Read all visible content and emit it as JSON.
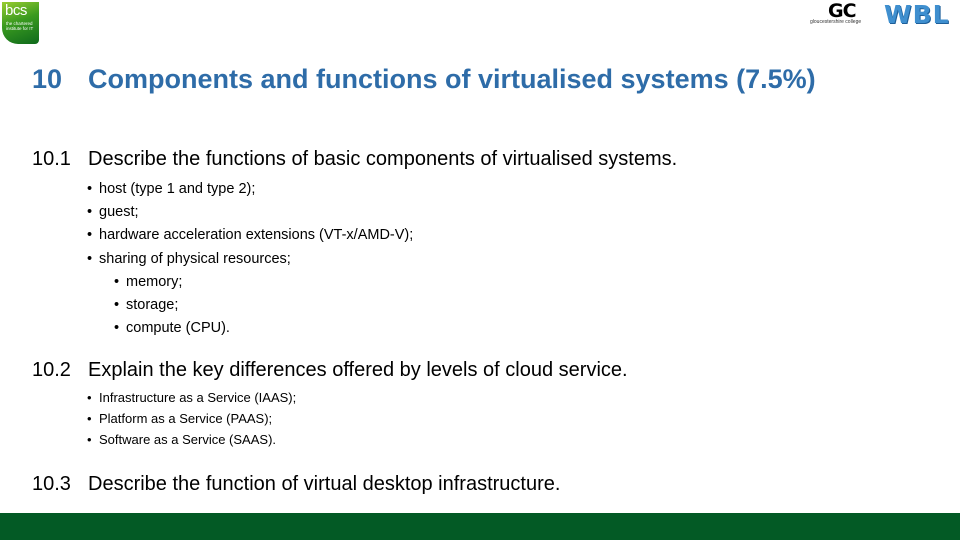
{
  "logos": {
    "bcs": {
      "word": "bcs",
      "tagline": "the chartered institute for IT"
    },
    "gc": {
      "word": "GC",
      "subtitle": "gloucestershire college"
    },
    "wbl": {
      "word": "WBL"
    }
  },
  "title": {
    "number": "10",
    "text": "Components and functions of virtualised systems (7.5%)",
    "color": "#2e6ca8"
  },
  "sections": [
    {
      "number": "10.1",
      "text": "Describe the functions of basic components of virtualised systems.",
      "bullets": [
        "host (type 1 and type 2);",
        "guest;",
        "hardware acceleration extensions (VT-x/AMD-V);",
        "sharing of physical resources;"
      ],
      "sub_bullets": [
        "memory;",
        " storage;",
        "compute (CPU)."
      ]
    },
    {
      "number": "10.2",
      "text": "Explain the key differences offered by levels of cloud service.",
      "bullets": [
        "Infrastructure as a Service (IAAS);",
        "Platform as a Service (PAAS);",
        "Software as a Service (SAAS)."
      ]
    },
    {
      "number": "10.3",
      "text": "Describe the function of virtual desktop infrastructure."
    }
  ],
  "footer": {
    "color": "#035a25"
  }
}
